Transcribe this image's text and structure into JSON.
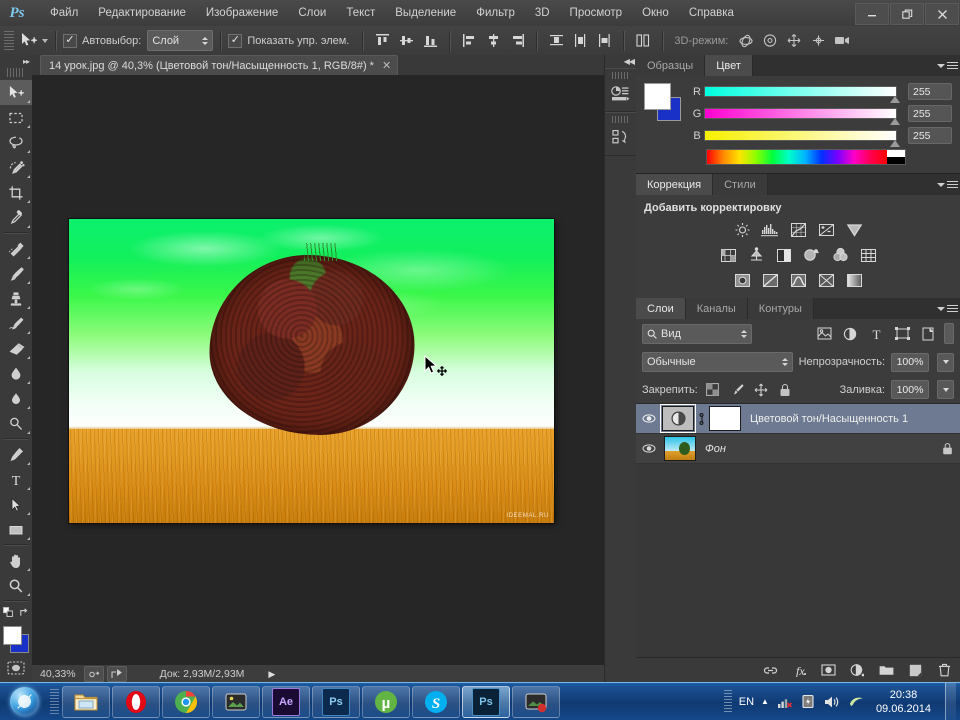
{
  "app": {
    "name": "Ps",
    "window_controls": {
      "minimize": "—",
      "restore": "❐",
      "close": "✕"
    }
  },
  "menubar": {
    "items": [
      {
        "label": "Файл"
      },
      {
        "label": "Редактирование"
      },
      {
        "label": "Изображение"
      },
      {
        "label": "Слои"
      },
      {
        "label": "Текст"
      },
      {
        "label": "Выделение"
      },
      {
        "label": "Фильтр"
      },
      {
        "label": "3D"
      },
      {
        "label": "Просмотр"
      },
      {
        "label": "Окно"
      },
      {
        "label": "Справка"
      }
    ]
  },
  "options_bar": {
    "tool": "move-tool",
    "autoselect_label": "Автовыбор:",
    "autoselect_checked": true,
    "autoselect_value": "Слой",
    "show_controls_label": "Показать упр. элем.",
    "show_controls_checked": true,
    "mode3d_label": "3D-режим:",
    "align_icons": [
      "align-top-edges",
      "align-vertical-centers",
      "align-bottom-edges",
      "align-left-edges",
      "align-horizontal-centers",
      "align-right-edges"
    ],
    "distribute_icons": [
      "distribute-top-edges",
      "distribute-vertical-centers",
      "distribute-bottom-edges",
      "distribute-left-edges",
      "distribute-horizontal-centers",
      "distribute-right-edges"
    ],
    "auto_align_icon": "auto-align-layers",
    "mode3d_icons": [
      "rotate-3d",
      "roll-3d",
      "pan-3d",
      "slide-3d",
      "scale-3d"
    ]
  },
  "toolbox": {
    "tools": [
      {
        "name": "move-tool",
        "selected": true
      },
      {
        "name": "rectangular-marquee-tool",
        "selected": false
      },
      {
        "name": "lasso-tool",
        "selected": false
      },
      {
        "name": "quick-selection-tool",
        "selected": false
      },
      {
        "name": "crop-tool",
        "selected": false
      },
      {
        "name": "eyedropper-tool",
        "selected": false
      },
      {
        "name": "spot-healing-brush-tool",
        "selected": false
      },
      {
        "name": "brush-tool",
        "selected": false
      },
      {
        "name": "clone-stamp-tool",
        "selected": false
      },
      {
        "name": "history-brush-tool",
        "selected": false
      },
      {
        "name": "eraser-tool",
        "selected": false
      },
      {
        "name": "gradient-tool",
        "selected": false
      },
      {
        "name": "blur-tool",
        "selected": false
      },
      {
        "name": "dodge-tool",
        "selected": false
      },
      {
        "name": "pen-tool",
        "selected": false
      },
      {
        "name": "horizontal-type-tool",
        "selected": false
      },
      {
        "name": "path-selection-tool",
        "selected": false
      },
      {
        "name": "rectangle-tool",
        "selected": false
      },
      {
        "name": "hand-tool",
        "selected": false
      },
      {
        "name": "zoom-tool",
        "selected": false
      }
    ],
    "foreground_color": "#ffffff",
    "background_color": "#1a31c8",
    "quick_mask_label": "quick-mask-mode"
  },
  "document": {
    "tab_title": "14 урок.jpg @ 40,3% (Цветовой тон/Насыщенность 1, RGB/8#) *",
    "close_label": "✕",
    "watermark": "IDEEMAL.RU"
  },
  "status_bar": {
    "zoom": "40,33%",
    "doc_size": "Док: 2,93M/2,93M",
    "arrow": "▶"
  },
  "color_panel": {
    "tabs": [
      {
        "label": "Образцы",
        "active": false
      },
      {
        "label": "Цвет",
        "active": true
      }
    ],
    "channels": [
      {
        "label": "R",
        "value": "255"
      },
      {
        "label": "G",
        "value": "255"
      },
      {
        "label": "B",
        "value": "255"
      }
    ],
    "foreground_color": "#ffffff",
    "background_color": "#1a31c8"
  },
  "adjustments_panel": {
    "tabs": [
      {
        "label": "Коррекция",
        "active": true
      },
      {
        "label": "Стили",
        "active": false
      }
    ],
    "heading": "Добавить корректировку",
    "row1_icons": [
      "brightness-contrast-icon",
      "levels-icon",
      "curves-icon",
      "exposure-icon",
      "vibrance-icon"
    ],
    "row2_icons": [
      "hue-saturation-icon",
      "color-balance-icon",
      "black-white-icon",
      "photo-filter-icon",
      "channel-mixer-icon",
      "color-lookup-icon"
    ],
    "row3_icons": [
      "invert-icon",
      "posterize-icon",
      "threshold-icon",
      "selective-color-icon",
      "gradient-map-icon"
    ]
  },
  "layers_panel": {
    "tabs": [
      {
        "label": "Слои",
        "active": true
      },
      {
        "label": "Каналы",
        "active": false
      },
      {
        "label": "Контуры",
        "active": false
      }
    ],
    "filter_value": "Вид",
    "filter_icons": [
      "filter-pixel-icon",
      "filter-adjustment-icon",
      "filter-type-icon",
      "filter-shape-icon",
      "filter-smart-object-icon"
    ],
    "blend_mode": "Обычные",
    "opacity_label": "Непрозрачность:",
    "opacity_value": "100%",
    "lock_label": "Закрепить:",
    "lock_icons": [
      "lock-transparent-pixels-icon",
      "lock-image-pixels-icon",
      "lock-position-icon",
      "lock-all-icon"
    ],
    "fill_label": "Заливка:",
    "fill_value": "100%",
    "layers": [
      {
        "name": "Цветовой тон/Насыщенность 1",
        "type": "adjustment",
        "visible": true,
        "selected": true,
        "locked": false,
        "has_mask": true
      },
      {
        "name": "Фон",
        "type": "image",
        "visible": true,
        "selected": false,
        "locked": true,
        "has_mask": false
      }
    ],
    "footer_icons": [
      "link-layers-icon",
      "add-layer-style-icon",
      "add-layer-mask-icon",
      "new-adjustment-layer-icon",
      "new-group-icon",
      "new-layer-icon",
      "delete-layer-icon"
    ]
  },
  "icon_dock": {
    "groups": [
      {
        "name": "histogram-info-group"
      },
      {
        "name": "history-actions-group"
      }
    ],
    "collapse_label": "◀◀"
  },
  "taskbar": {
    "start_label": "start-orb",
    "buttons": [
      {
        "name": "windows-explorer",
        "label": "",
        "icon": "folder-icon",
        "active": false
      },
      {
        "name": "opera-browser",
        "label": "O",
        "icon": "opera-icon",
        "active": false
      },
      {
        "name": "google-chrome",
        "label": "",
        "icon": "chrome-icon",
        "active": false
      },
      {
        "name": "picture-viewer",
        "label": "",
        "icon": "photo-icon",
        "active": false
      },
      {
        "name": "after-effects",
        "label": "Ae",
        "icon": "after-effects-icon",
        "active": false
      },
      {
        "name": "photoshop-pinned",
        "label": "Ps",
        "icon": "photoshop-icon",
        "active": false
      },
      {
        "name": "utorrent",
        "label": "µ",
        "icon": "utorrent-icon",
        "active": false
      },
      {
        "name": "skype",
        "label": "S",
        "icon": "skype-icon",
        "active": false
      },
      {
        "name": "photoshop-running",
        "label": "Ps",
        "icon": "photoshop-icon",
        "active": true
      },
      {
        "name": "screen-recorder",
        "label": "",
        "icon": "recorder-icon",
        "active": false
      }
    ],
    "tray": {
      "language": "EN",
      "show_hidden": "▲",
      "icons": [
        "network-icon",
        "flash-update-icon",
        "volume-icon",
        "nvidia-icon"
      ],
      "time": "20:38",
      "date": "09.06.2014"
    }
  }
}
